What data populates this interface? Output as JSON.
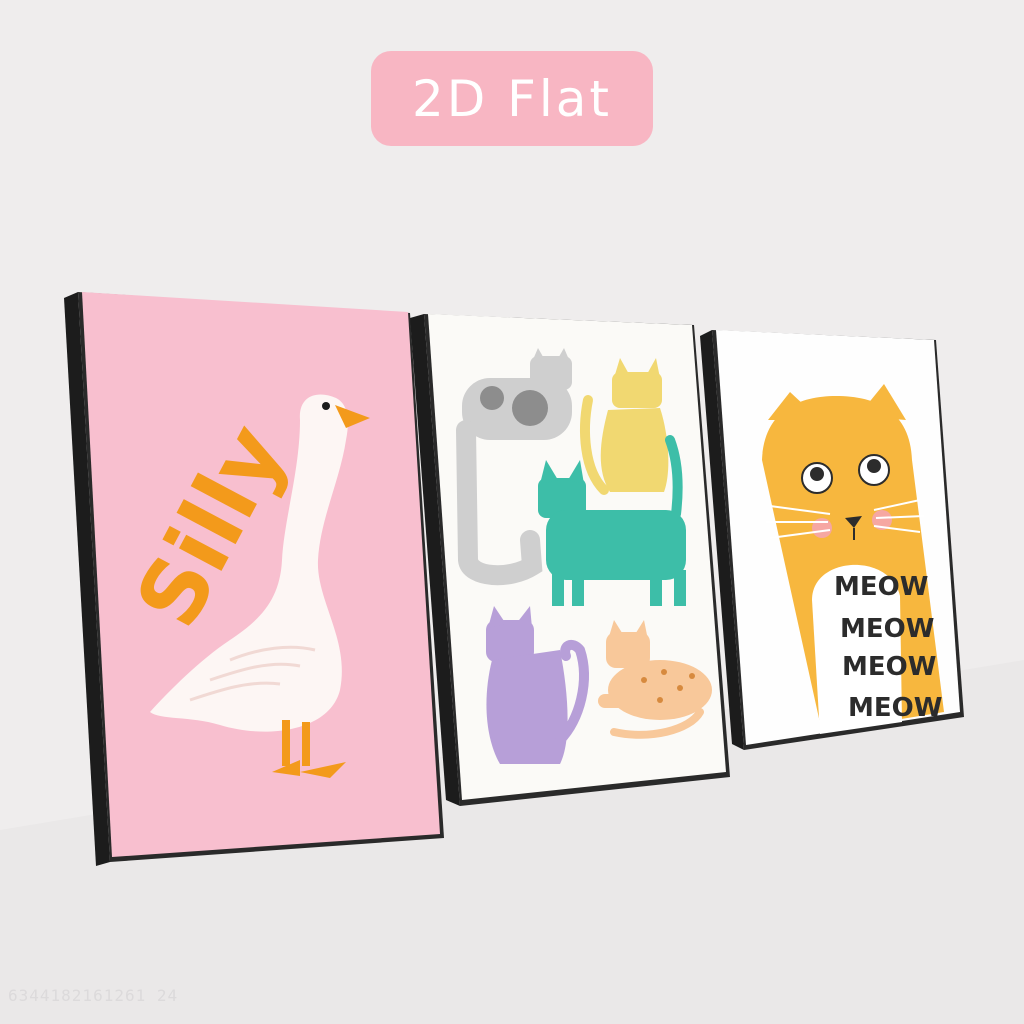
{
  "badge": {
    "label": "2D Flat"
  },
  "watermark": {
    "text": "6344182161261 24"
  },
  "posters": {
    "left": {
      "word": "Silly",
      "background": "#f8bfcf",
      "accent": "#f39a1b"
    },
    "middle": {
      "background": "#fbfaf7"
    },
    "right": {
      "background": "#fefefe",
      "cat_color": "#f7b73e",
      "meow_lines": [
        "MEOW",
        "MEOW",
        "MEOW",
        "MEOW"
      ]
    }
  }
}
